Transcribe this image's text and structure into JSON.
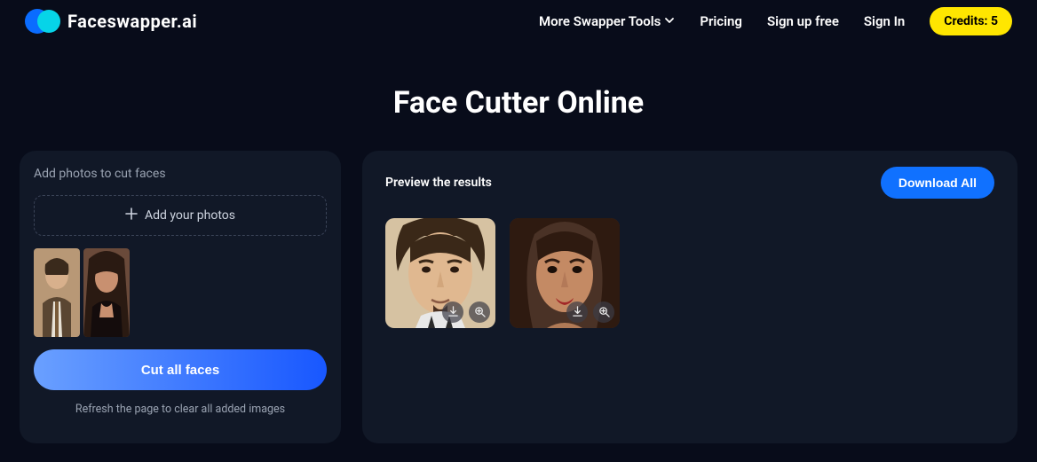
{
  "brand": "Faceswapper.ai",
  "nav": {
    "tools": "More Swapper Tools",
    "pricing": "Pricing",
    "signup": "Sign up free",
    "signin": "Sign In",
    "credits": "Credits: 5"
  },
  "title": "Face Cutter Online",
  "left": {
    "heading": "Add photos to cut faces",
    "add_label": "Add your photos",
    "cut_label": "Cut all faces",
    "hint": "Refresh the page to clear all added images"
  },
  "right": {
    "heading": "Preview the results",
    "download_all": "Download All"
  }
}
